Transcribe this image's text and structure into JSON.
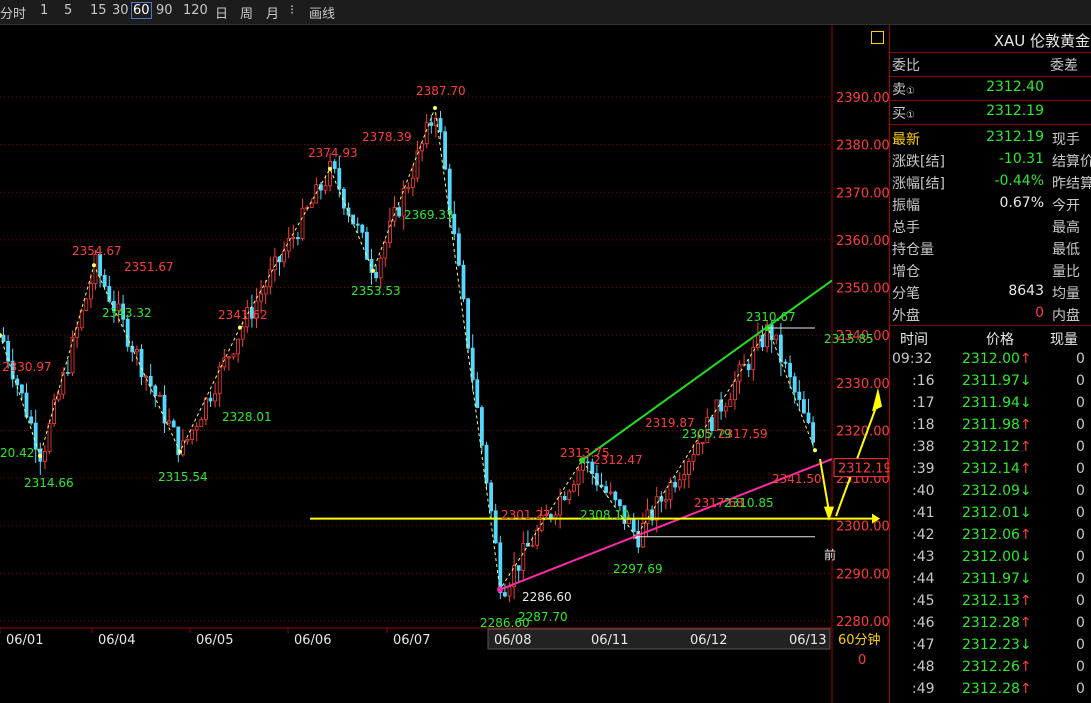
{
  "toolbar": {
    "items": [
      "分时",
      "1",
      "5",
      "15",
      "30",
      "60",
      "90",
      "120",
      "日",
      "周",
      "月",
      "⁝",
      "画线"
    ],
    "active": "60"
  },
  "panel": {
    "title": "XAU 伦敦黄金",
    "header_left": "委比",
    "header_right": "委差",
    "sell_label": "卖",
    "sell_price": "2312.40",
    "buy_label": "买",
    "buy_price": "2312.19",
    "quote_rows": [
      {
        "label": "最新",
        "value": "2312.19",
        "value_color": "green",
        "right": "现手",
        "label_yellow": true
      },
      {
        "label": "涨跌[结]",
        "value": "-10.31",
        "value_color": "green",
        "right": "结算价"
      },
      {
        "label": "涨幅[结]",
        "value": "-0.44%",
        "value_color": "green",
        "right": "昨结算"
      },
      {
        "label": "振幅",
        "value": "0.67%",
        "value_color": "white",
        "right": "今开"
      },
      {
        "label": "总手",
        "value": "",
        "value_color": "white",
        "right": "最高"
      },
      {
        "label": "持仓量",
        "value": "",
        "value_color": "white",
        "right": "最低"
      },
      {
        "label": "增仓",
        "value": "",
        "value_color": "white",
        "right": "量比"
      },
      {
        "label": "分笔",
        "value": "8643",
        "value_color": "white",
        "right": "均量"
      },
      {
        "label": "外盘",
        "value": "0",
        "value_color": "red",
        "right": "内盘"
      }
    ],
    "ticks_header": {
      "time": "时间",
      "price": "价格",
      "vol": "现量"
    },
    "ticks": [
      {
        "time": "09:32",
        "price": "2312.00↑",
        "vol": "0"
      },
      {
        "time": ":16",
        "price": "2311.97↓",
        "vol": "0"
      },
      {
        "time": ":17",
        "price": "2311.94↓",
        "vol": "0"
      },
      {
        "time": ":18",
        "price": "2311.98↑",
        "vol": "0"
      },
      {
        "time": ":38",
        "price": "2312.12↑",
        "vol": "0"
      },
      {
        "time": ":39",
        "price": "2312.14↑",
        "vol": "0"
      },
      {
        "time": ":40",
        "price": "2312.09↓",
        "vol": "0"
      },
      {
        "time": ":41",
        "price": "2312.01↓",
        "vol": "0"
      },
      {
        "time": ":42",
        "price": "2312.06↑",
        "vol": "0"
      },
      {
        "time": ":43",
        "price": "2312.00↓",
        "vol": "0"
      },
      {
        "time": ":44",
        "price": "2311.97↓",
        "vol": "0"
      },
      {
        "time": ":45",
        "price": "2312.13↑",
        "vol": "0"
      },
      {
        "time": ":46",
        "price": "2312.28↑",
        "vol": "0"
      },
      {
        "time": ":47",
        "price": "2312.23↓",
        "vol": "0"
      },
      {
        "time": ":48",
        "price": "2312.26↑",
        "vol": "0"
      },
      {
        "time": ":49",
        "price": "2312.28↑",
        "vol": "0"
      }
    ]
  },
  "chart_data": {
    "type": "candlestick",
    "ylim": [
      2278,
      2395
    ],
    "yticks": [
      "2390.00",
      "2380.00",
      "2370.00",
      "2360.00",
      "2350.00",
      "2340.00",
      "2330.00",
      "2320.00",
      "2310.00",
      "2300.00",
      "2290.00",
      "2280.00"
    ],
    "xticks": [
      "06/01",
      "06/04",
      "06/05",
      "06/06",
      "06/07",
      "06/08",
      "06/11",
      "06/12",
      "06/13"
    ],
    "x_period_label": "60分钟",
    "x_bottom_value": "0",
    "current_price_tag": "2312.19",
    "annotations": [
      {
        "text": "2387.70",
        "color": "red"
      },
      {
        "text": "2378.39",
        "color": "red"
      },
      {
        "text": "2374.93",
        "color": "red"
      },
      {
        "text": "2369.33",
        "color": "green"
      },
      {
        "text": "2354.67",
        "color": "red"
      },
      {
        "text": "2351.67",
        "color": "red"
      },
      {
        "text": "2353.53",
        "color": "green"
      },
      {
        "text": "2343.32",
        "color": "green"
      },
      {
        "text": "2341.62",
        "color": "red"
      },
      {
        "text": "2330.97",
        "color": "red"
      },
      {
        "text": "2328.01",
        "color": "green"
      },
      {
        "text": "20.42",
        "color": "green"
      },
      {
        "text": "2314.66",
        "color": "green"
      },
      {
        "text": "2315.54",
        "color": "green"
      },
      {
        "text": "2301.27",
        "color": "red"
      },
      {
        "text": "2286.60",
        "color": "white"
      },
      {
        "text": "2287.70",
        "color": "green"
      },
      {
        "text": "2286.60",
        "color": "green"
      },
      {
        "text": "2313.75",
        "color": "red"
      },
      {
        "text": "2312.47",
        "color": "red"
      },
      {
        "text": "2308.10",
        "color": "green"
      },
      {
        "text": "2297.69",
        "color": "green"
      },
      {
        "text": "2319.87",
        "color": "red"
      },
      {
        "text": "2305.79",
        "color": "green"
      },
      {
        "text": "2317.59",
        "color": "red"
      },
      {
        "text": "2317.68",
        "color": "red"
      },
      {
        "text": "2310.85",
        "color": "green"
      },
      {
        "text": "2310.67",
        "color": "green"
      },
      {
        "text": "2341.50",
        "color": "red"
      },
      {
        "text": "2315.85",
        "color": "green"
      },
      {
        "text": "前",
        "color": "white"
      },
      {
        "text": "前",
        "color": "white"
      }
    ],
    "zigzag": [
      [
        0,
        2340
      ],
      [
        40,
        2314.66
      ],
      [
        94,
        2354.67
      ],
      [
        180,
        2315.54
      ],
      [
        240,
        2341.62
      ],
      [
        330,
        2374.93
      ],
      [
        373,
        2353.53
      ],
      [
        435,
        2387.7
      ],
      [
        500,
        2286.6
      ],
      [
        582,
        2313.75
      ],
      [
        636,
        2297.69
      ],
      [
        768,
        2341.5
      ],
      [
        815,
        2315.85
      ]
    ],
    "colors": {
      "up": "#ff3c3c",
      "down": "#54d8ff",
      "grid": "#8b0000",
      "frame": "#a00000",
      "fib_green": "#22dd22",
      "trend_pink": "#ff2aa8",
      "support_yellow": "#ffff00",
      "zigzag": "#ffff66"
    }
  }
}
